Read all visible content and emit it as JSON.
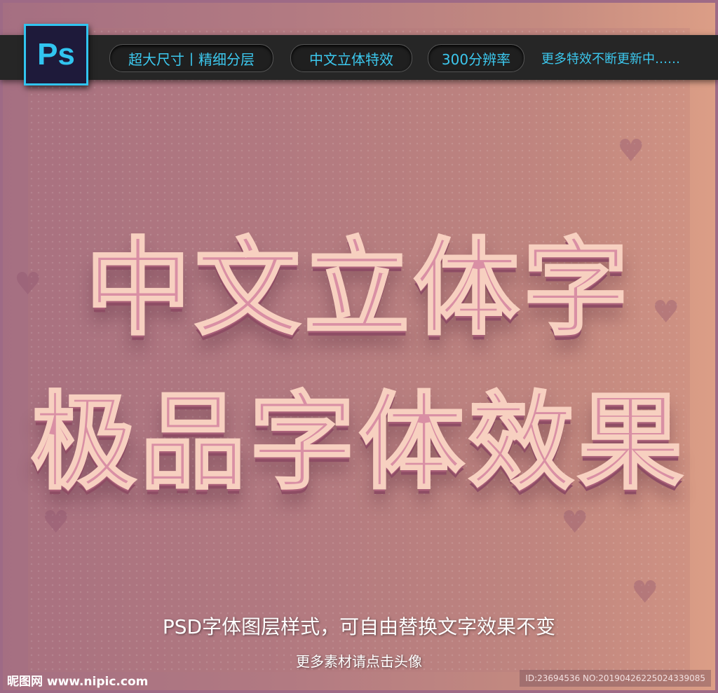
{
  "header": {
    "app_icon_label": "Ps",
    "pills": [
      "超大尺寸丨精细分层",
      "中文立体特效",
      "300分辨率"
    ],
    "more_text": "更多特效不断更新中……"
  },
  "main": {
    "line1": "中文立体字",
    "line2": "极品字体效果"
  },
  "footer": {
    "subtitle": "PSD字体图层样式，可自由替换文字效果不变",
    "caption": "更多素材请点击头像",
    "watermark": "昵图网 www.nipic.com",
    "id_text": "ID:23694536 NO:20190426225024339085"
  },
  "colors": {
    "accent": "#3cc8ee",
    "text_fill": "#d98fa4",
    "bar": "#262626"
  }
}
